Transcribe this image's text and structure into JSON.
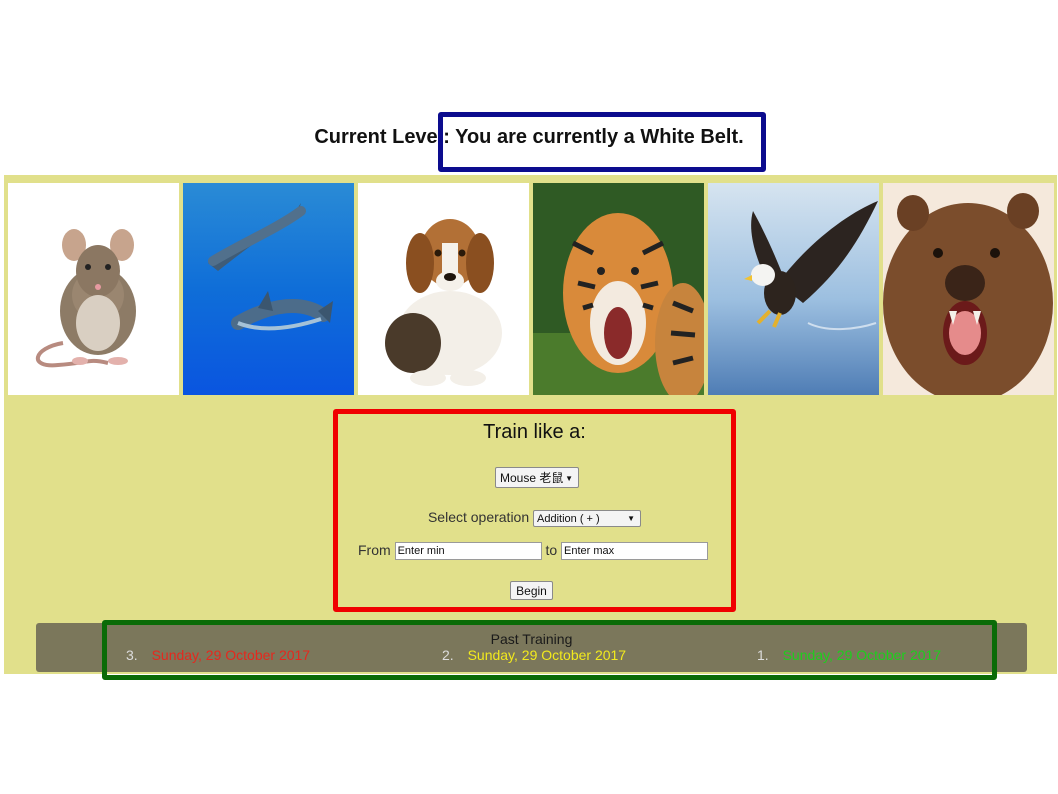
{
  "header": {
    "level_text": "Current Level: You are currently a White Belt."
  },
  "gallery": [
    {
      "name": "mouse"
    },
    {
      "name": "dolphin"
    },
    {
      "name": "dog"
    },
    {
      "name": "tiger"
    },
    {
      "name": "eagle"
    },
    {
      "name": "bear"
    }
  ],
  "train": {
    "title": "Train like a:",
    "animal_selected": "Mouse 老鼠",
    "operation_label": "Select operation",
    "operation_selected": "Addition ( + )",
    "from_label": "From",
    "min_placeholder": "Enter min",
    "to_label": "to",
    "max_placeholder": "Enter max",
    "begin_label": "Begin"
  },
  "past": {
    "title": "Past Training",
    "entries": [
      {
        "num": "3.",
        "date": "Sunday, 29 October 2017",
        "color": "#e5281e"
      },
      {
        "num": "2.",
        "date": "Sunday, 29 October 2017",
        "color": "#f2ea1d"
      },
      {
        "num": "1.",
        "date": "Sunday, 29 October 2017",
        "color": "#1dcf1d"
      }
    ]
  },
  "colors": {
    "panel": "#e1e08b",
    "level_box": "#0c0c8e",
    "train_box": "#f00000",
    "past_box": "#0a6b07",
    "past_bar": "#7b775b"
  }
}
